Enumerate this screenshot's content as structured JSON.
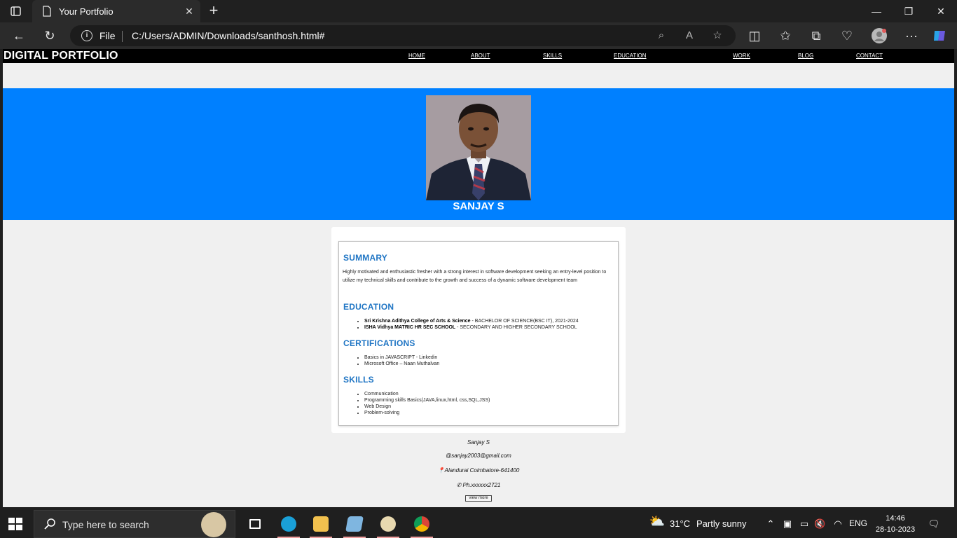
{
  "browser": {
    "tab_title": "Your Portfolio",
    "address_scheme": "File",
    "address_url": "C:/Users/ADMIN/Downloads/santhosh.html#"
  },
  "site": {
    "logo": "DIGITAL PORTFOLIO",
    "nav": [
      "HOME",
      "ABOUT",
      "SKILLS",
      "EDUCATION",
      "WORK",
      "BLOG",
      "CONTACT"
    ],
    "name": "SANJAY S"
  },
  "resume": {
    "summary_title": "SUMMARY",
    "summary_text": "Highly motivated and enthusiastic fresher with a strong interest in software development seeking an entry-level position to utilize my technical skills and contribute to the growth and success of a dynamic software development team",
    "education_title": "EDUCATION",
    "education": [
      {
        "school": "Sri Krishna Adithya College of Arts & Science",
        "detail": " - BACHELOR OF SCIENCE(BSC IT), 2021-2024"
      },
      {
        "school": "ISHA Vidhya MATRIC HR SEC SCHOOL",
        "detail": " - SECONDARY AND HIGHER SECONDARY SCHOOL"
      }
    ],
    "certifications_title": "CERTIFICATIONS",
    "certifications": [
      "Basics in JAVASCRIPT - Linkedin",
      "Microsoft Office – Naan Muthalvan"
    ],
    "skills_title": "SKILLS",
    "skills": [
      "Communication",
      "Programming skills Basics(JAVA,linux,html, css,SQL,JSS)",
      "Web Design",
      "Problem-solving"
    ]
  },
  "footer": {
    "name": "Sanjay S",
    "email": "@sanjay2003@gmail.com",
    "location": "📍Alandurai Coimbatore-641400",
    "phone": "✆ Ph.xxxxxx2721",
    "view_more": "view more"
  },
  "taskbar": {
    "search_placeholder": "Type here to search",
    "weather_temp": "31°C",
    "weather_desc": "Partly sunny",
    "language": "ENG",
    "time": "14:46",
    "date": "28-10-2023"
  },
  "colors": {
    "hero_blue": "#0080ff",
    "section_title": "#1f75c4",
    "nav_bg": "#000000"
  }
}
